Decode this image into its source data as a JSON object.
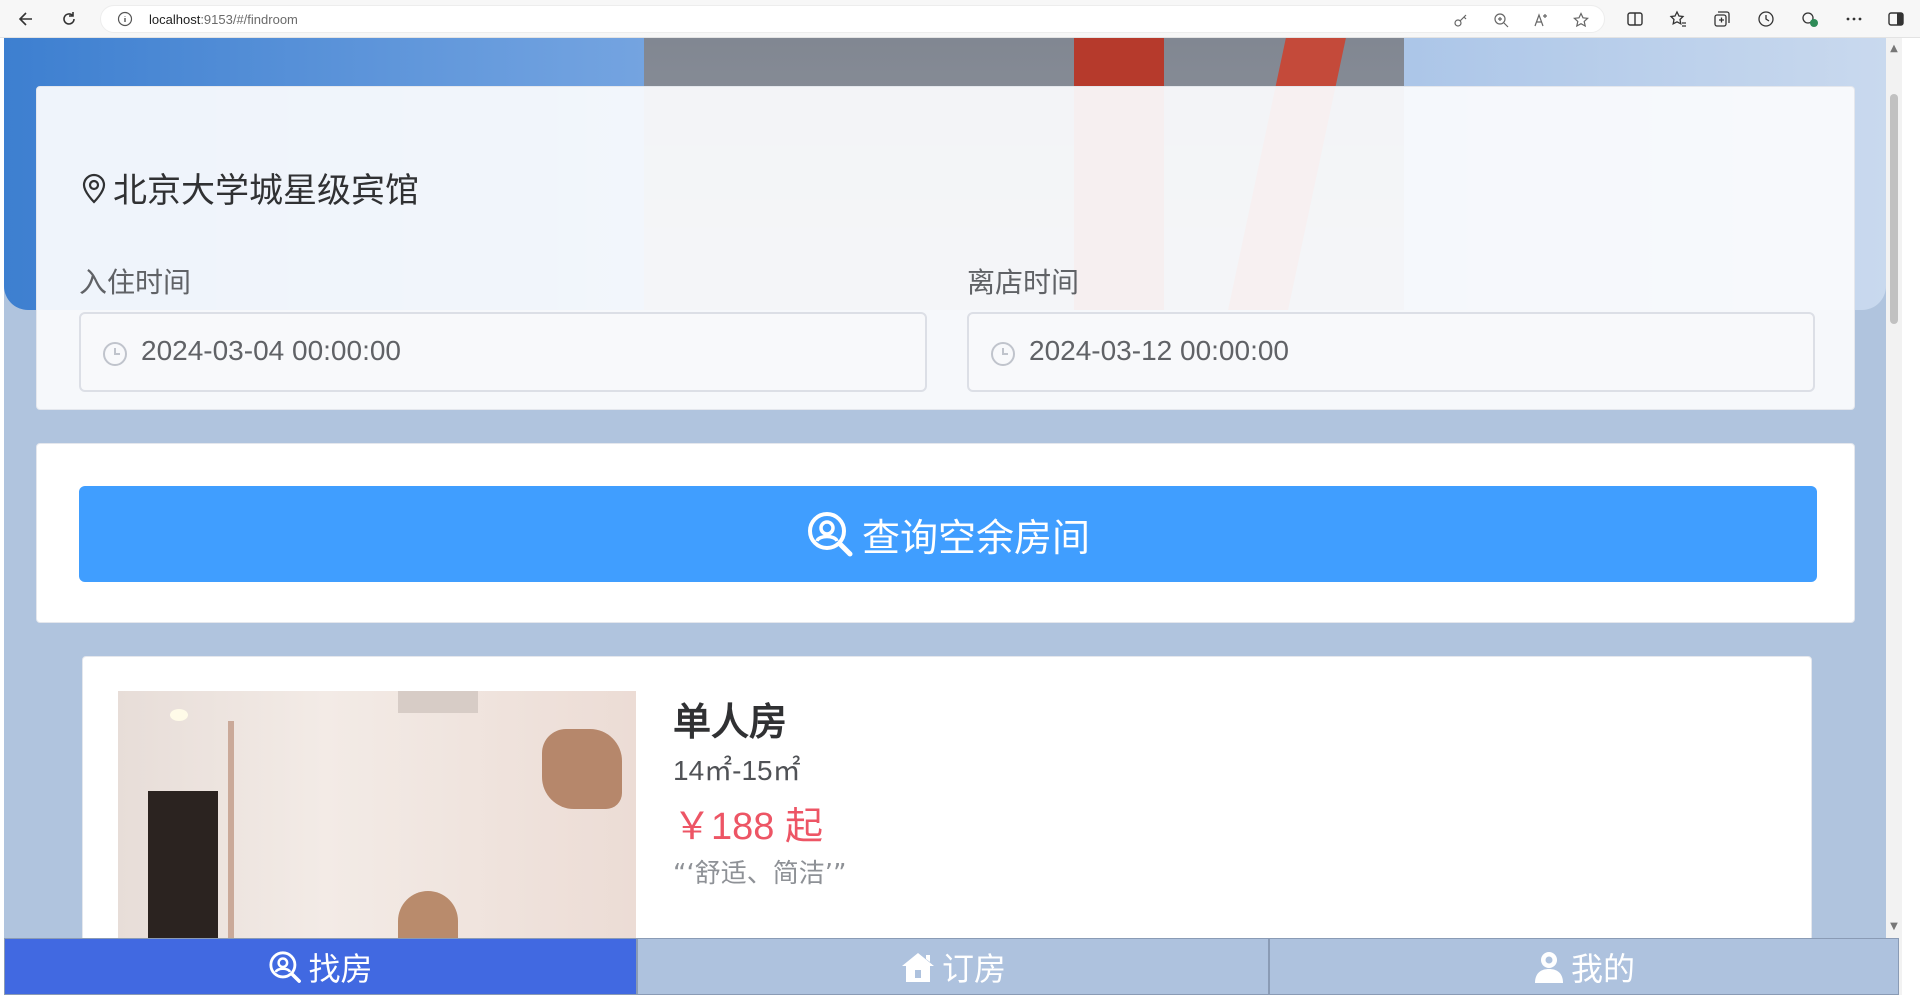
{
  "browser": {
    "url_host": "localhost",
    "url_rest": ":9153/#/findroom"
  },
  "hotel": {
    "name": "北京大学城星级宾馆"
  },
  "dates": {
    "checkin_label": "入住时间",
    "checkin_value": "2024-03-04 00:00:00",
    "checkout_label": "离店时间",
    "checkout_value": "2024-03-12 00:00:00"
  },
  "search": {
    "button_label": "查询空余房间"
  },
  "rooms": [
    {
      "name": "单人房",
      "area": "14㎡-15㎡",
      "price": "￥188 起",
      "description": "“‘舒适、简洁’”"
    }
  ],
  "tabbar": {
    "items": [
      {
        "label": "找房",
        "icon": "search-icon",
        "active": true
      },
      {
        "label": "订房",
        "icon": "home-icon",
        "active": false
      },
      {
        "label": "我的",
        "icon": "user-icon",
        "active": false
      }
    ]
  },
  "colors": {
    "primary_button": "#409eff",
    "tab_active": "#4169e1",
    "price": "#ed5565",
    "page_bg": "#b0c4de"
  }
}
